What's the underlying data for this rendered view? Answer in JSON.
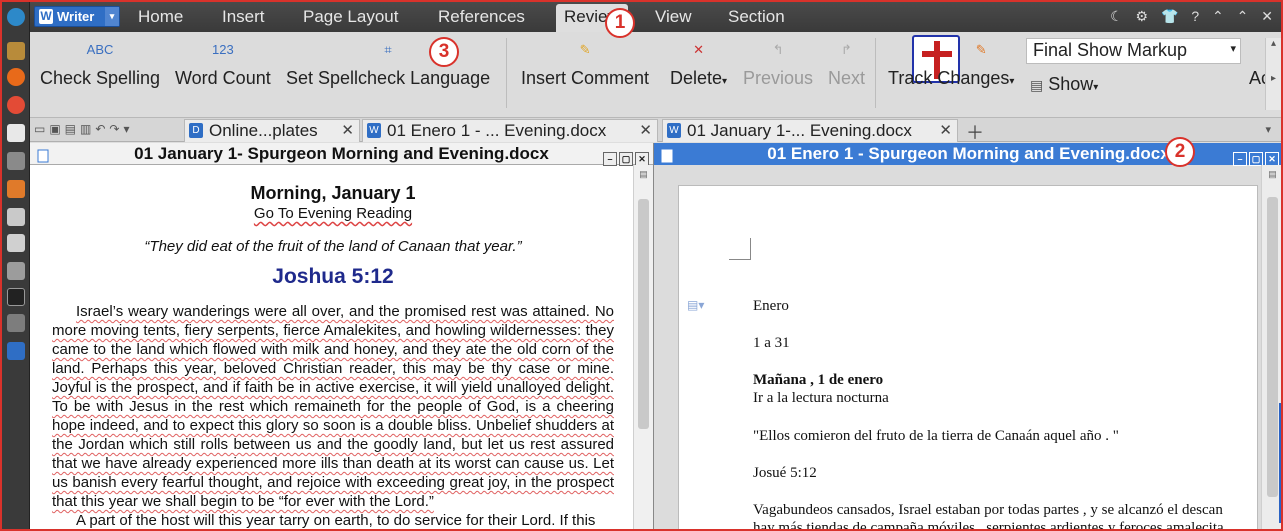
{
  "menubar": {
    "app_label": "Writer",
    "items": [
      "Home",
      "Insert",
      "Page Layout",
      "References",
      "Review",
      "View",
      "Section"
    ],
    "active": "Review",
    "tray": [
      "☾",
      "⚙",
      "👕",
      "?",
      "⌃",
      "⌃",
      "✕"
    ]
  },
  "ribbon": {
    "check_spelling": "Check Spelling",
    "word_count": "Word Count",
    "set_spellcheck_language": "Set Spellcheck Language",
    "insert_comment": "Insert Comment",
    "delete": "Delete",
    "previous": "Previous",
    "next": "Next",
    "track_changes": "Track Changes",
    "markup_mode": "Final Show Markup",
    "show": "Show",
    "accept": "Ac",
    "abc_icon": "ABC",
    "count_icon": "123"
  },
  "tabs": [
    {
      "label": "Online...plates",
      "icon": "D"
    },
    {
      "label": "01 Enero 1 - ... Evening.docx",
      "icon": "W"
    },
    {
      "label": "01 January 1-... Evening.docx",
      "icon": "W"
    }
  ],
  "callouts": [
    "1",
    "2",
    "3"
  ],
  "left_pane": {
    "title": "01 January 1- Spurgeon Morning and Evening.docx",
    "heading": "Morning, January 1",
    "link": "Go To Evening Reading",
    "quote": "“They did eat of the fruit of the land of Canaan that year.”",
    "reference": "Joshua 5:12",
    "body": "Israel’s weary wanderings were all over, and the promised rest was attained. No more moving tents, fiery serpents, fierce Amalekites, and howling wildernesses: they came to the land which flowed with milk and honey, and they ate the old corn of the land. Perhaps this year, beloved Christian reader, this may be thy case or mine. Joyful is the prospect, and if faith be in active exercise, it will yield unalloyed delight. To be with Jesus in the rest which remaineth for the people of God, is a cheering hope indeed, and to expect this glory so soon is a double bliss. Unbelief shudders at the Jordan which still rolls between us and the goodly land, but let us rest assured that we have already experienced more ills than death at its worst can cause us. Let us banish every fearful thought, and rejoice with exceeding great joy, in the prospect that this year we shall begin to be “for ever with the Lord.”",
    "body2": "A part of the host will this year tarry on earth, to do service for their Lord. If this"
  },
  "right_pane": {
    "title": "01 Enero 1 - Spurgeon Morning and Evening.docx",
    "lines": [
      "Enero",
      "1 a 31",
      "Mañana , 1 de enero",
      "Ir a la lectura nocturna",
      "\"Ellos comieron del fruto de la tierra de Canaán aquel año . \"",
      "Josué 5:12",
      "Vagabundeos cansados, Israel estaban por todas partes , y se alcanzó el descan",
      "hay más tiendas de campaña móviles , serpientes ardientes y feroces amalecita"
    ]
  }
}
